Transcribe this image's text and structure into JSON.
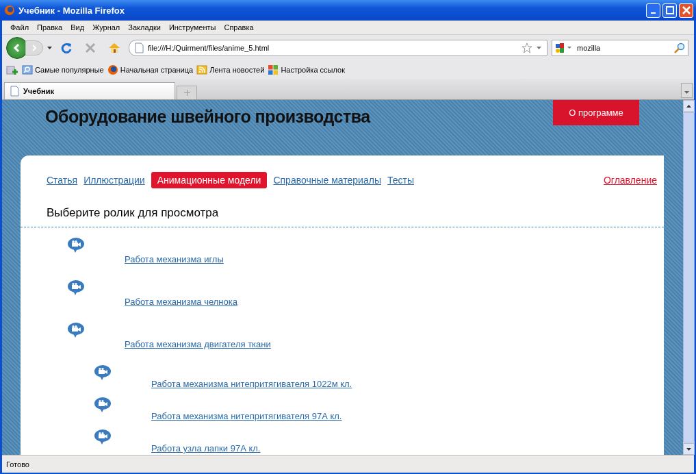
{
  "window": {
    "title": "Учебник - Mozilla Firefox"
  },
  "menu": [
    "Файл",
    "Правка",
    "Вид",
    "Журнал",
    "Закладки",
    "Инструменты",
    "Справка"
  ],
  "address": {
    "value": "file:///H:/Quirment/files/anime_5.html"
  },
  "search": {
    "value": "mozilla"
  },
  "bookmarks": [
    {
      "kind": "popular",
      "label": "Самые популярные"
    },
    {
      "kind": "firefox",
      "label": "Начальная страница"
    },
    {
      "kind": "feed",
      "label": "Лента новостей"
    },
    {
      "kind": "windows",
      "label": "Настройка ссылок"
    }
  ],
  "tabs": [
    {
      "label": "Учебник",
      "selected": true
    }
  ],
  "page": {
    "site_title": "Оборудование швейного производства",
    "about_button": "О программе",
    "nav": [
      {
        "label": "Статья",
        "selected": false
      },
      {
        "label": "Иллюстрации",
        "selected": false
      },
      {
        "label": "Анимационные модели",
        "selected": true
      },
      {
        "label": "Справочные материалы",
        "selected": false
      },
      {
        "label": "Тесты",
        "selected": false
      }
    ],
    "contents_link": "Оглавление",
    "heading": "Выберите ролик для просмотра",
    "videos": [
      {
        "label": "Работа механизма иглы"
      },
      {
        "label": "Работа механизма челнока"
      },
      {
        "label": "Работа механизма двигателя ткани",
        "children": [
          {
            "label": "Работа механизма нитепритягивателя 1022м кл."
          },
          {
            "label": "Работа механизма нитепритягивателя 97А кл."
          },
          {
            "label": "Работа узла лапки 97А кл."
          }
        ]
      }
    ]
  },
  "status_bar": "Готово"
}
